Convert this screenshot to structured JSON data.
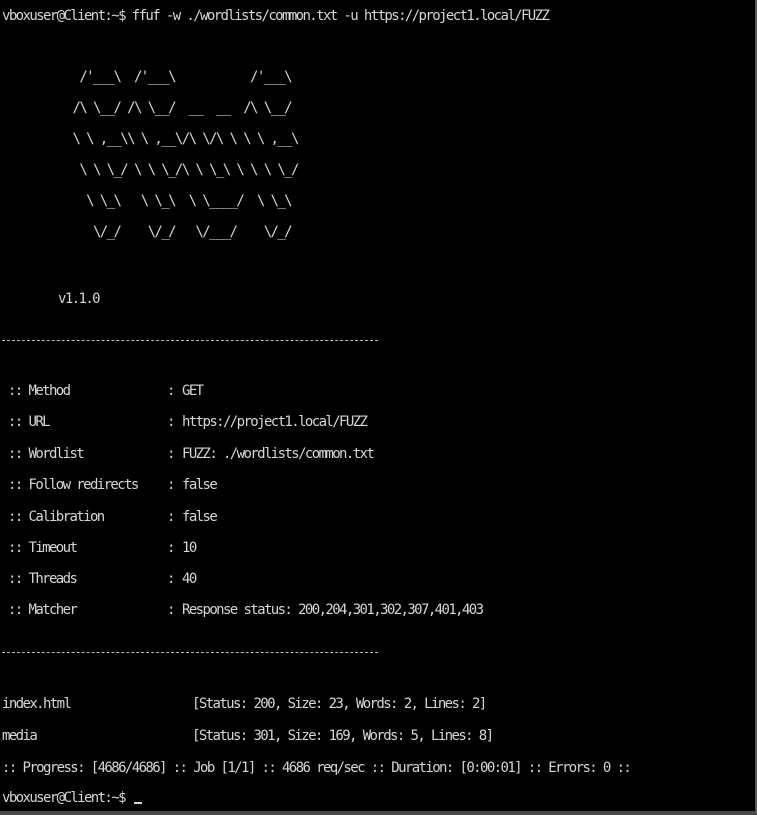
{
  "terminal": {
    "command_line": "vboxuser@Client:~$ ffuf -w ./wordlists/common.txt -u https://project1.local/FUZZ",
    "banner_art": "    /'___\\  /'___\\           /'___\\\n   /\\ \\__/ /\\ \\__/  __  __  /\\ \\__/\n   \\ \\ ,__\\\\ \\ ,__\\/\\ \\/\\ \\ \\ \\ ,__\\\n    \\ \\ \\_/ \\ \\ \\_/\\ \\ \\_\\ \\ \\ \\ \\_/\n     \\ \\_\\   \\ \\_\\  \\ \\____/  \\ \\_\\\n      \\/_/    \\/_/   \\/___/    \\/_/",
    "version": "v1.1.0",
    "separator": "________________________________________________",
    "config": [
      {
        "key": ":: Method",
        "value": "GET"
      },
      {
        "key": ":: URL",
        "value": "https://project1.local/FUZZ"
      },
      {
        "key": ":: Wordlist",
        "value": "FUZZ: ./wordlists/common.txt"
      },
      {
        "key": ":: Follow redirects",
        "value": "false"
      },
      {
        "key": ":: Calibration",
        "value": "false"
      },
      {
        "key": ":: Timeout",
        "value": "10"
      },
      {
        "key": ":: Threads",
        "value": "40"
      },
      {
        "key": ":: Matcher",
        "value": "Response status: 200,204,301,302,307,401,403"
      }
    ],
    "config_separator": ":",
    "results": [
      {
        "name": "index.html",
        "info": "[Status: 200, Size: 23, Words: 2, Lines: 2]"
      },
      {
        "name": "media",
        "info": "[Status: 301, Size: 169, Words: 5, Lines: 8]"
      }
    ],
    "progress_line": ":: Progress: [4686/4686] :: Job [1/1] :: 4686 req/sec :: Duration: [0:00:01] :: Errors: 0 ::",
    "prompt": "vboxuser@Client:~$ "
  },
  "colors": {
    "background": "#000000",
    "foreground": "#d6d6d6"
  }
}
